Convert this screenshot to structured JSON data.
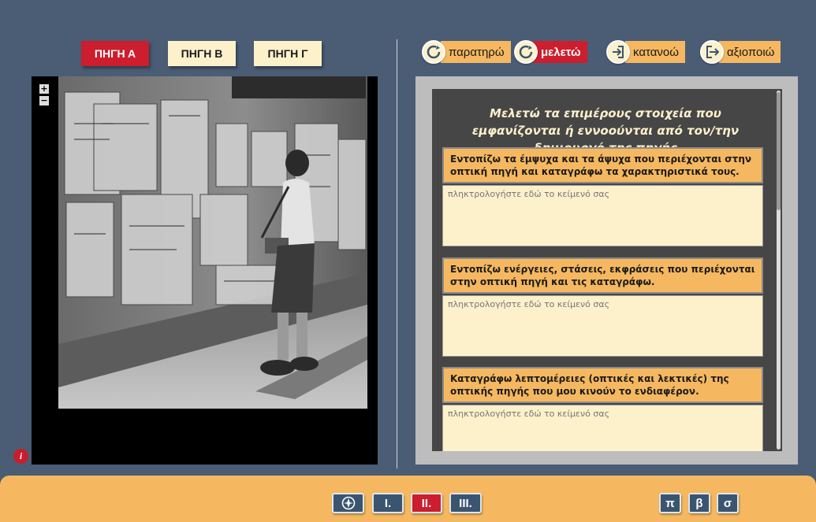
{
  "sources": {
    "tabs": [
      {
        "label": "ΠΗΓΗ Α",
        "active": true
      },
      {
        "label": "ΠΗΓΗ Β",
        "active": false
      },
      {
        "label": "ΠΗΓΗ Γ",
        "active": false
      }
    ]
  },
  "viewer": {
    "zoom_in": "+",
    "zoom_out": "−",
    "info": "i"
  },
  "steps": [
    {
      "label": "παρατηρώ",
      "icon": "cycle-icon",
      "active": false
    },
    {
      "label": "μελετώ",
      "icon": "cycle-icon",
      "active": true
    },
    {
      "label": "κατανοώ",
      "icon": "enter-icon",
      "active": false
    },
    {
      "label": "αξιοποιώ",
      "icon": "exit-icon",
      "active": false
    }
  ],
  "panel": {
    "title": "Μελετώ τα επιμέρους στοιχεία που εμφανίζονται ή εννοούνται από τον/την δημιουργό της πηγής",
    "questions": [
      {
        "prompt": "Εντοπίζω τα έμψυχα και τα άψυχα που περιέχονται στην οπτική πηγή και καταγράφω τα χαρακτηριστικά τους.",
        "placeholder": "πληκτρολογήστε εδώ το κείμενό σας"
      },
      {
        "prompt": "Εντοπίζω ενέργειες, στάσεις, εκφράσεις που περιέχονται στην οπτική πηγή και τις καταγράφω.",
        "placeholder": "πληκτρολογήστε εδώ το κείμενό σας"
      },
      {
        "prompt": "Καταγράφω λεπτομέρειες (οπτικές και λεκτικές) της οπτικής πηγής που μου κινούν το ενδιαφέρον.",
        "placeholder": "πληκτρολογήστε εδώ το κείμενό σας"
      }
    ]
  },
  "footer": {
    "nav": [
      {
        "label": "",
        "icon": "compass-icon",
        "active": false
      },
      {
        "label": "I.",
        "active": false
      },
      {
        "label": "II.",
        "active": true
      },
      {
        "label": "III.",
        "active": false
      }
    ],
    "tools": [
      {
        "label": "π"
      },
      {
        "label": "β"
      },
      {
        "label": "σ"
      }
    ]
  },
  "colors": {
    "background": "#4a5d75",
    "accent_red": "#cc1e2e",
    "accent_orange": "#f5b860",
    "cream": "#fdf1cc"
  }
}
